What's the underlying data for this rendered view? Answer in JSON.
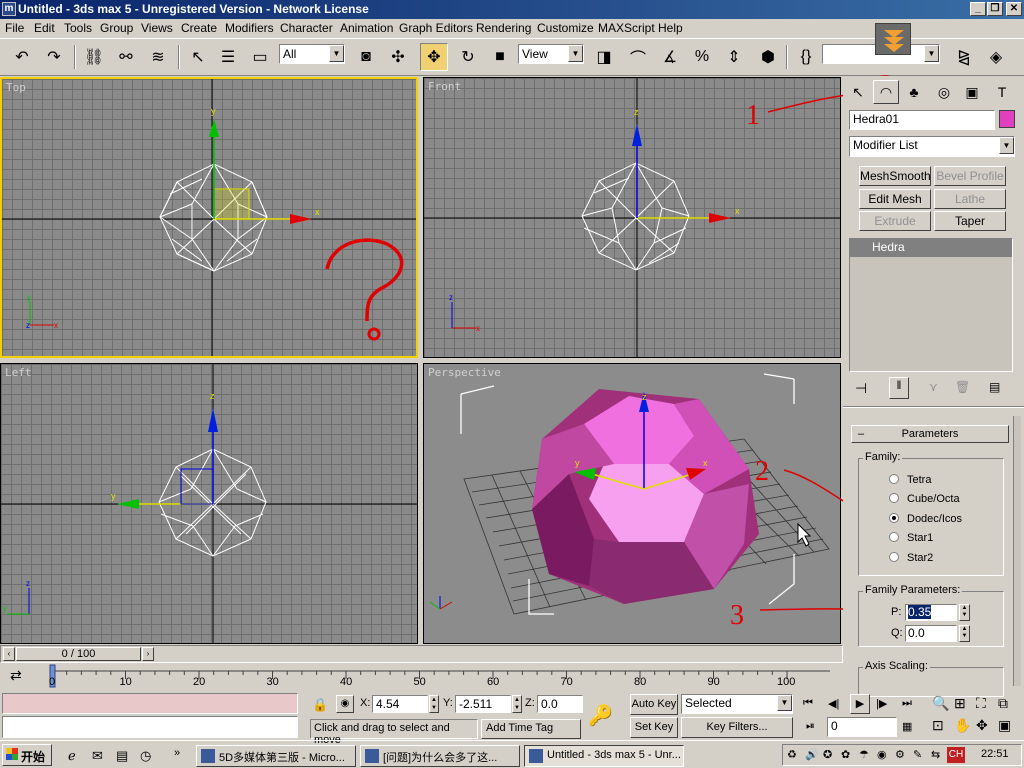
{
  "window": {
    "title": "Untitled - 3ds max 5 - Unregistered Version - Network License",
    "app_icon": "3ds-max-icon"
  },
  "menu": [
    "File",
    "Edit",
    "Tools",
    "Group",
    "Views",
    "Create",
    "Modifiers",
    "Character",
    "Animation",
    "Graph Editors",
    "Rendering",
    "Customize",
    "MAXScript",
    "Help"
  ],
  "toolbar": {
    "selection_filter": "All",
    "ref_coord_system": "View",
    "named_selection": ""
  },
  "viewports": {
    "top": {
      "label": "Top",
      "active": true
    },
    "front": {
      "label": "Front"
    },
    "left": {
      "label": "Left"
    },
    "perspective": {
      "label": "Perspective"
    },
    "axis": {
      "x": "x",
      "y": "y",
      "z": "z"
    }
  },
  "annotations": {
    "n1": "1",
    "n2": "2",
    "n3": "3",
    "question": "?"
  },
  "command_panel": {
    "object_name": "Hedra01",
    "object_color": "#e040c0",
    "modifier_list": "Modifier List",
    "buttons": {
      "meshsmooth": "MeshSmooth",
      "bevel_profile": "Bevel Profile",
      "edit_mesh": "Edit Mesh",
      "lathe": "Lathe",
      "extrude": "Extrude",
      "taper": "Taper"
    },
    "stack_item": "Hedra",
    "rollout_title": "Parameters",
    "family_label": "Family:",
    "family_options": [
      "Tetra",
      "Cube/Octa",
      "Dodec/Icos",
      "Star1",
      "Star2"
    ],
    "family_selected": 2,
    "family_params_label": "Family Parameters:",
    "p_label": "P:",
    "p_value": "0.35",
    "q_label": "Q:",
    "q_value": "0.0",
    "axis_scaling_label": "Axis Scaling:"
  },
  "timeline": {
    "frame_display": "0 / 100",
    "ticks": [
      "0",
      "10",
      "20",
      "30",
      "40",
      "50",
      "60",
      "70",
      "80",
      "90",
      "100"
    ]
  },
  "status": {
    "x_label": "X:",
    "x_value": "4.54",
    "y_label": "Y:",
    "y_value": "-2.511",
    "z_label": "Z:",
    "z_value": "0.0",
    "prompt": "Click and drag to select and move",
    "add_time_tag": "Add Time Tag",
    "auto_key": "Auto Key",
    "set_key": "Set Key",
    "key_mode": "Selected",
    "key_filters": "Key Filters...",
    "current_frame": "0"
  },
  "taskbar": {
    "start": "开始",
    "tasks": [
      "5D多媒体第三版 - Micro...",
      "[问题]为什么会多了这...",
      "Untitled - 3ds max 5 - Unr..."
    ],
    "active_task": 2,
    "lang": "CH",
    "clock": "22:51"
  }
}
